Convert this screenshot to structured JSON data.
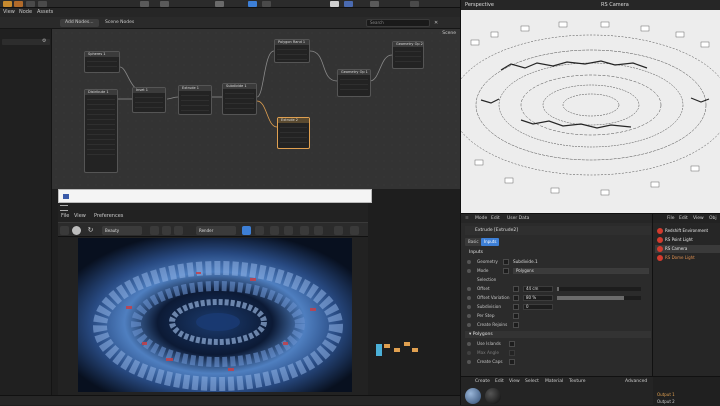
{
  "menubar": {
    "items": [
      "View",
      "Node",
      "Assets"
    ]
  },
  "node_editor": {
    "tabs": [
      "Add Nodes...",
      "Scene Nodes"
    ],
    "search_placeholder": "Search",
    "scene_tab": "Scene",
    "nodes": [
      {
        "id": "spheres",
        "title": "Spheres 1"
      },
      {
        "id": "distribute",
        "title": "Distribute 1"
      },
      {
        "id": "inset",
        "title": "Inset 1"
      },
      {
        "id": "extrude1",
        "title": "Extrude 1"
      },
      {
        "id": "subdivide",
        "title": "Subdivide 1"
      },
      {
        "id": "polygon",
        "title": "Polygon Rand 1"
      },
      {
        "id": "geometry",
        "title": "Geometry Op 1"
      },
      {
        "id": "extrude2",
        "title": "Extrude 2"
      },
      {
        "id": "output",
        "title": "Geometry Op 2"
      }
    ]
  },
  "render_view": {
    "menu": [
      "File",
      "View",
      "Preferences"
    ],
    "dropdown1": "Beauty",
    "dropdown2": "Render"
  },
  "viewport": {
    "title": "Perspective",
    "camera": "RS Camera"
  },
  "attribute_manager": {
    "menu": [
      "Mode",
      "Edit",
      "User Data"
    ],
    "title": "Extrude [Extrude2]",
    "tabs": [
      "Basic",
      "Inputs"
    ],
    "section_inputs": "Inputs",
    "rows": {
      "geometry": {
        "label": "Geometry",
        "value": "Subdivide.1"
      },
      "mode": {
        "label": "Mode",
        "value": "Polygons"
      },
      "selection": {
        "label": "Selection"
      },
      "offset": {
        "label": "Offset",
        "value": "44 cm",
        "fill": 0.02
      },
      "offset_variation": {
        "label": "Offset Variation",
        "value": "80 %",
        "fill": 0.8
      },
      "subdivision": {
        "label": "Subdivision",
        "value": "0"
      },
      "per_step": {
        "label": "Per Step"
      },
      "create_rejoins": {
        "label": "Create Rejoins"
      },
      "section_polygons": "Polygons",
      "use_islands": {
        "label": "Use Islands"
      },
      "max_angle": {
        "label": "Max Angle"
      },
      "create_caps": {
        "label": "Create Caps"
      }
    }
  },
  "object_manager": {
    "menu": [
      "File",
      "Edit",
      "View",
      "Obj"
    ],
    "items": [
      {
        "name": "Redshift Environment",
        "color": "#d23b2e"
      },
      {
        "name": "RS Point Light",
        "color": "#d23b2e"
      },
      {
        "name": "RS Camera",
        "color": "#d23b2e"
      },
      {
        "name": "RS Dome Light",
        "color": "#d23b2e"
      }
    ]
  },
  "material_manager": {
    "menu": [
      "Create",
      "Edit",
      "View",
      "Select",
      "Material",
      "Texture"
    ],
    "advanced": "Advanced",
    "outputs": [
      "Output 1",
      "Output 2"
    ]
  },
  "colors": {
    "accent_orange": "#e0a050",
    "accent_blue": "#3d7fd6",
    "light_red": "#d23b2e"
  }
}
